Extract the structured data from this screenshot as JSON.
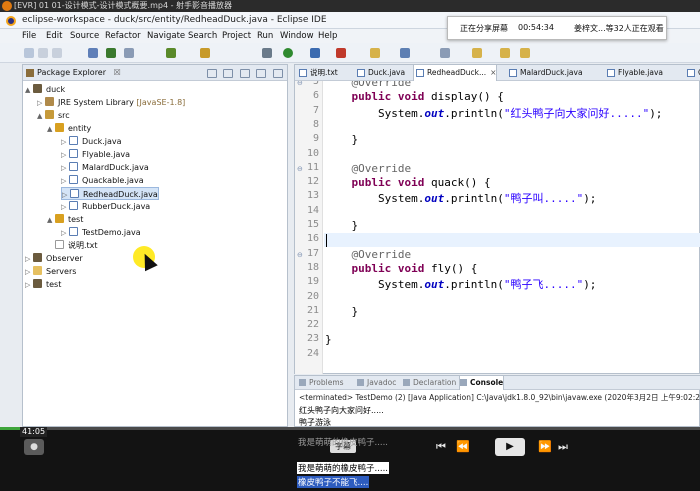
{
  "player": {
    "title": "[EVR] 01 01-设计模式-设计模式概要.mp4 - 射手影音播放器",
    "time_code": "41:05",
    "subtitle_button": "字幕",
    "progress": 0.06,
    "controls": [
      "⏮",
      "⏪",
      "⏩",
      "⏭"
    ],
    "play_icon": "▶"
  },
  "eclipse": {
    "title": "eclipse-workspace - duck/src/entity/RedheadDuck.java - Eclipse IDE",
    "menu": [
      "File",
      "Edit",
      "Source",
      "Refactor",
      "Navigate",
      "Search",
      "Project",
      "Run",
      "Window",
      "Help"
    ]
  },
  "share_banner": {
    "status": "正在分享屏幕",
    "timer": "00:54:34",
    "viewers": "姜梓文...等32人正在观看"
  },
  "package_explorer": {
    "title": "Package Explorer",
    "close": "☒",
    "tree": [
      {
        "label": "duck",
        "arrow": "▲",
        "icon": "proj",
        "indent": 0
      },
      {
        "label": "JRE System Library",
        "extra": "[JavaSE-1.8]",
        "arrow": "▷",
        "icon": "lib",
        "indent": 1
      },
      {
        "label": "src",
        "arrow": "▲",
        "icon": "src",
        "indent": 1
      },
      {
        "label": "entity",
        "arrow": "▲",
        "icon": "pkg",
        "indent": 2
      },
      {
        "label": "Duck.java",
        "arrow": "▷",
        "icon": "java",
        "indent": 3
      },
      {
        "label": "Flyable.java",
        "arrow": "▷",
        "icon": "java",
        "indent": 3
      },
      {
        "label": "MalardDuck.java",
        "arrow": "▷",
        "icon": "java",
        "indent": 3
      },
      {
        "label": "Quackable.java",
        "arrow": "▷",
        "icon": "java",
        "indent": 3
      },
      {
        "label": "RedheadDuck.java",
        "arrow": "▷",
        "icon": "java",
        "indent": 3,
        "selected": true
      },
      {
        "label": "RubberDuck.java",
        "arrow": "▷",
        "icon": "java",
        "indent": 3
      },
      {
        "label": "test",
        "arrow": "▲",
        "icon": "pkg",
        "indent": 2
      },
      {
        "label": "TestDemo.java",
        "arrow": "▷",
        "icon": "java",
        "indent": 3
      },
      {
        "label": "说明.txt",
        "arrow": "",
        "icon": "txt",
        "indent": 2
      },
      {
        "label": "Observer",
        "arrow": "▷",
        "icon": "proj",
        "indent": 0
      },
      {
        "label": "Servers",
        "arrow": "▷",
        "icon": "folder",
        "indent": 0
      },
      {
        "label": "test",
        "arrow": "▷",
        "icon": "proj",
        "indent": 0
      }
    ]
  },
  "editor": {
    "tabs": [
      {
        "label": "说明.txt"
      },
      {
        "label": "Duck.java"
      },
      {
        "label": "RedheadDuck...",
        "active": true
      },
      {
        "label": "MalardDuck.java"
      },
      {
        "label": "Flyable.java"
      },
      {
        "label": "Q"
      }
    ],
    "close": "×",
    "lines": [
      {
        "n": "5",
        "fold": "⊖",
        "html": "    <span class=\"ann\">@Override</span>"
      },
      {
        "n": "6",
        "html": "    <span class=\"kw\">public void</span> display() {"
      },
      {
        "n": "7",
        "html": "        System.<span class=\"fld\">out</span>.println(<span class=\"str\">\"红头鸭子向大家问好.....\"</span>);"
      },
      {
        "n": "8",
        "html": ""
      },
      {
        "n": "9",
        "html": "    }"
      },
      {
        "n": "10",
        "html": ""
      },
      {
        "n": "11",
        "fold": "⊖",
        "html": "    <span class=\"ann\">@Override</span>"
      },
      {
        "n": "12",
        "html": "    <span class=\"kw\">public void</span> quack() {"
      },
      {
        "n": "13",
        "html": "        System.<span class=\"fld\">out</span>.println(<span class=\"str\">\"鸭子叫.....\"</span>);"
      },
      {
        "n": "14",
        "html": ""
      },
      {
        "n": "15",
        "html": "    }"
      },
      {
        "n": "16",
        "html": "",
        "current": true
      },
      {
        "n": "17",
        "fold": "⊖",
        "html": "    <span class=\"ann\">@Override</span>"
      },
      {
        "n": "18",
        "html": "    <span class=\"kw\">public void</span> fly() {"
      },
      {
        "n": "19",
        "html": "        System.<span class=\"fld\">out</span>.println(<span class=\"str\">\"鸭子飞.....\"</span>);"
      },
      {
        "n": "20",
        "html": ""
      },
      {
        "n": "21",
        "html": "    }"
      },
      {
        "n": "22",
        "html": ""
      },
      {
        "n": "23",
        "html": "}"
      },
      {
        "n": "24",
        "html": ""
      }
    ]
  },
  "console": {
    "tabs": [
      "Problems",
      "Javadoc",
      "Declaration",
      "Console"
    ],
    "active_tab": "Console",
    "status": "<terminated> TestDemo (2) [Java Application] C:\\Java\\jdk1.8.0_92\\bin\\javaw.exe (2020年3月2日 上午9:02:20)",
    "output": [
      "红头鸭子向大家问好.....",
      "鸭子游泳",
      "我是萌萌的橡皮鸭子.....",
      "我是萌萌的橡皮鸭子.....",
      "橡皮鸭子不能飞...."
    ]
  }
}
